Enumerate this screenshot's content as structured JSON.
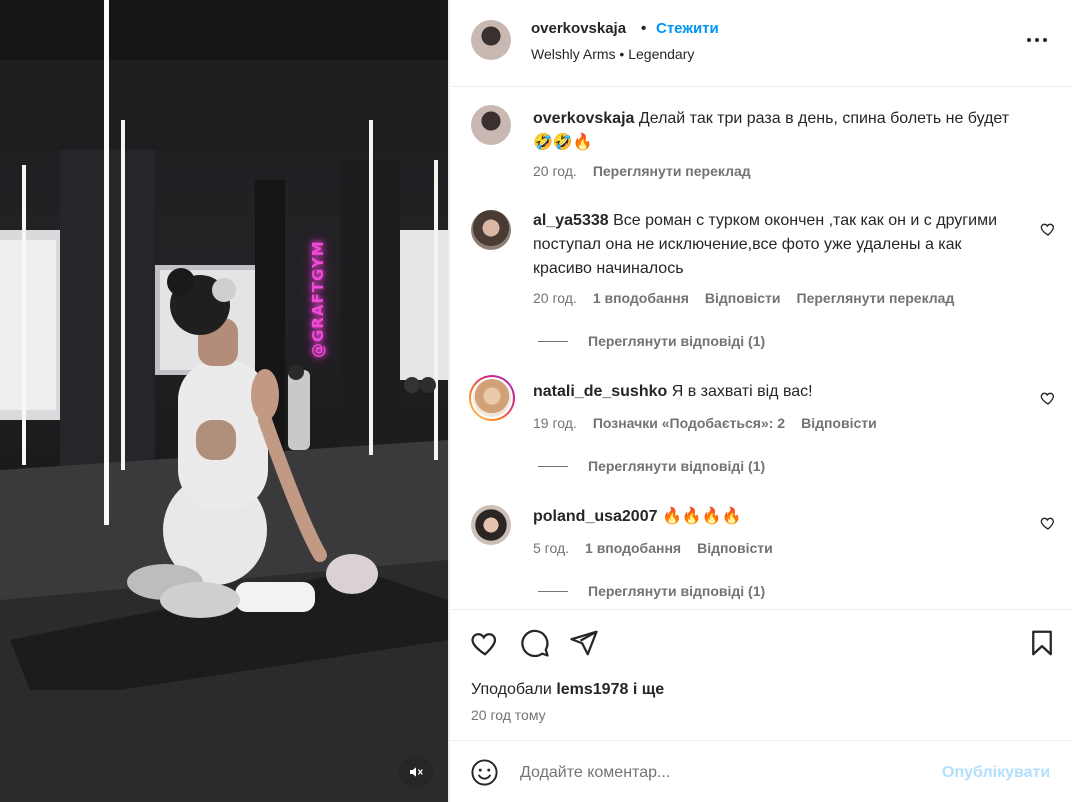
{
  "header": {
    "username": "overkovskaja",
    "dot": "•",
    "follow_label": "Стежити",
    "music": "Welshly Arms • Legendary"
  },
  "video": {
    "neon_sign": "@GRAFTGYM",
    "muted": true
  },
  "caption": {
    "username": "overkovskaja",
    "text": "Делай так три раза в день, спина болеть не будет 🤣🤣🔥",
    "time": "20 год.",
    "translate_label": "Переглянути переклад"
  },
  "comments": [
    {
      "username": "al_ya5338",
      "text": "Все роман с турком окончен ,так как он и с другими поступал она не исключение,все фото уже удалены а как красиво начиналось",
      "time": "20 год.",
      "likes": "1 вподобання",
      "reply_label": "Відповісти",
      "translate_label": "Переглянути переклад",
      "view_replies": "Переглянути відповіді (1)"
    },
    {
      "username": "natali_de_sushko",
      "text": "Я в захваті від вас!",
      "time": "19 год.",
      "likes": "Позначки «Подобається»: 2",
      "reply_label": "Відповісти",
      "view_replies": "Переглянути відповіді (1)"
    },
    {
      "username": "poland_usa2007",
      "text": "🔥🔥🔥🔥",
      "time": "5 год.",
      "likes": "1 вподобання",
      "reply_label": "Відповісти",
      "view_replies": "Переглянути відповіді (1)"
    }
  ],
  "actions": {
    "liked_by_prefix": "Уподобали",
    "liked_by_user": "lems1978",
    "liked_by_suffix": "і ще",
    "post_time": "20 год тому"
  },
  "composer": {
    "placeholder": "Додайте коментар...",
    "publish_label": "Опублікувати"
  },
  "colors": {
    "accent": "#0095f6",
    "publish_disabled": "#b2dffc",
    "secondary_text": "#737373"
  }
}
